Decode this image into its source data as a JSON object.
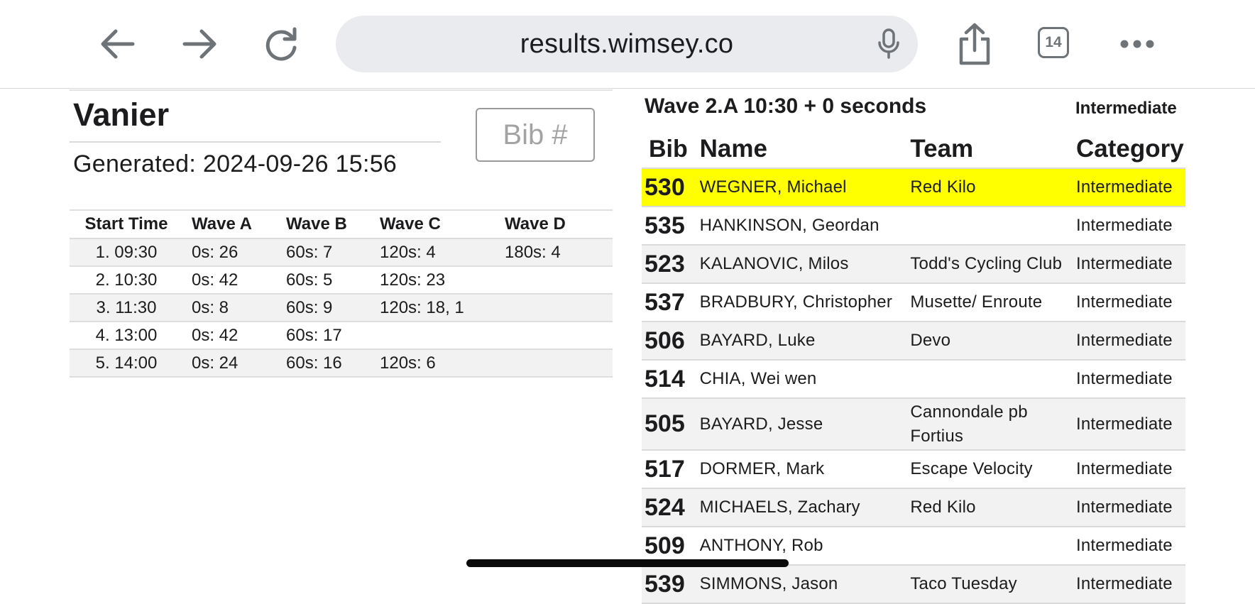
{
  "browser": {
    "url": "results.wimsey.co",
    "tab_count": "14",
    "icons": [
      "back-arrow-icon",
      "forward-arrow-icon",
      "reload-icon",
      "microphone-icon",
      "share-icon",
      "tabs-icon",
      "more-icon"
    ]
  },
  "page": {
    "title": "Vanier",
    "generated": "Generated: 2024-09-26 15:56",
    "bib_placeholder": "Bib #"
  },
  "waves_table": {
    "headers": [
      "Start Time",
      "Wave A",
      "Wave B",
      "Wave C",
      "Wave D"
    ],
    "rows": [
      [
        "1. 09:30",
        "0s: 26",
        "60s: 7",
        "120s: 4",
        "180s: 4"
      ],
      [
        "2. 10:30",
        "0s: 42",
        "60s: 5",
        "120s: 23",
        ""
      ],
      [
        "3. 11:30",
        "0s: 8",
        "60s: 9",
        "120s: 18, 1",
        ""
      ],
      [
        "4. 13:00",
        "0s: 42",
        "60s: 17",
        "",
        ""
      ],
      [
        "5. 14:00",
        "0s: 24",
        "60s: 16",
        "120s: 6",
        ""
      ]
    ]
  },
  "results": {
    "wave_heading": "Wave 2.A 10:30 + 0 seconds",
    "wave_category": "Intermediate",
    "headers": {
      "bib": "Bib",
      "name": "Name",
      "team": "Team",
      "category": "Category"
    },
    "highlight_color": "#ffff00",
    "rows": [
      {
        "bib": "530",
        "name": "WEGNER, Michael",
        "team": "Red Kilo",
        "category": "Intermediate",
        "highlighted": true
      },
      {
        "bib": "535",
        "name": "HANKINSON, Geordan",
        "team": "",
        "category": "Intermediate"
      },
      {
        "bib": "523",
        "name": "KALANOVIC, Milos",
        "team": "Todd's Cycling Club",
        "category": "Intermediate"
      },
      {
        "bib": "537",
        "name": "BRADBURY, Christopher",
        "team": "Musette/ Enroute",
        "category": "Intermediate"
      },
      {
        "bib": "506",
        "name": "BAYARD, Luke",
        "team": "Devo",
        "category": "Intermediate"
      },
      {
        "bib": "514",
        "name": "CHIA, Wei wen",
        "team": "",
        "category": "Intermediate"
      },
      {
        "bib": "505",
        "name": "BAYARD, Jesse",
        "team": "Cannondale pb Fortius",
        "category": "Intermediate"
      },
      {
        "bib": "517",
        "name": "DORMER, Mark",
        "team": "Escape Velocity",
        "category": "Intermediate"
      },
      {
        "bib": "524",
        "name": "MICHAELS, Zachary",
        "team": "Red Kilo",
        "category": "Intermediate"
      },
      {
        "bib": "509",
        "name": "ANTHONY, Rob",
        "team": "",
        "category": "Intermediate"
      },
      {
        "bib": "539",
        "name": "SIMMONS, Jason",
        "team": "Taco Tuesday",
        "category": "Intermediate"
      }
    ]
  }
}
